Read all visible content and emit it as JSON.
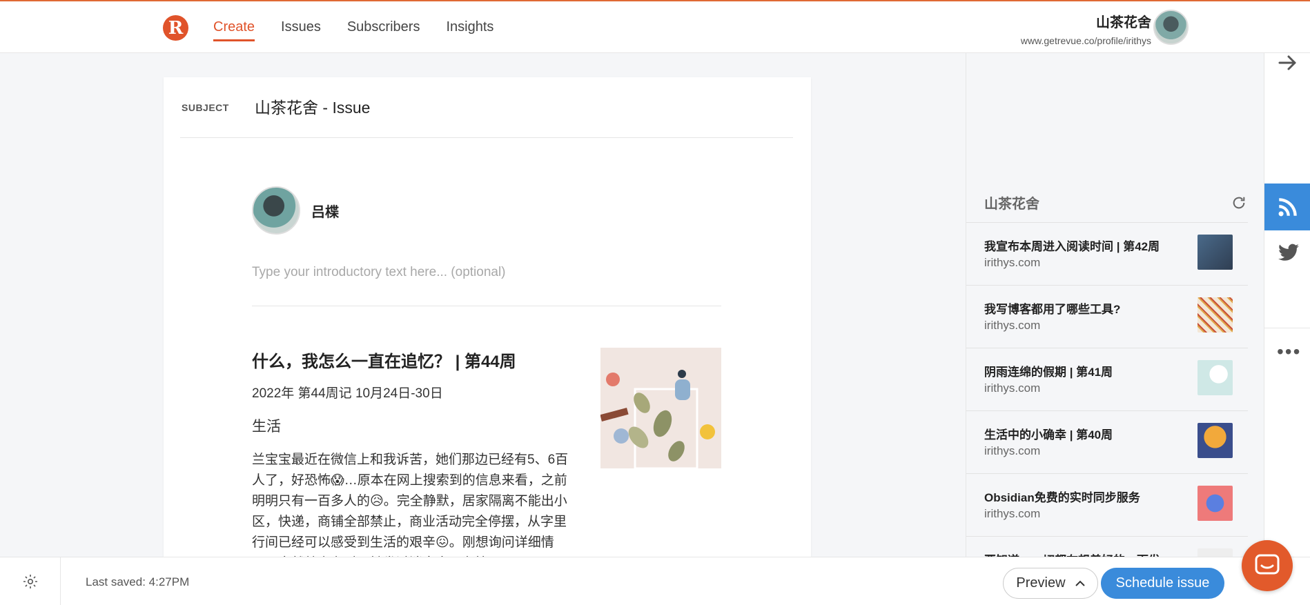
{
  "app": {
    "logo_letter": "R",
    "nav": [
      {
        "label": "Create",
        "active": true
      },
      {
        "label": "Issues"
      },
      {
        "label": "Subscribers"
      },
      {
        "label": "Insights"
      }
    ],
    "profile": {
      "name": "山茶花舍",
      "url": "www.getrevue.co/profile/irithys"
    },
    "accent_color": "#e0532a",
    "primary_color": "#3a8bdb"
  },
  "editor": {
    "subject_label": "SUBJECT",
    "subject_value": "山茶花舍 - Issue",
    "author_name": "吕楪",
    "intro_placeholder": "Type your introductory text here... (optional)",
    "article": {
      "title": "什么，我怎么一直在追忆？ | 第44周",
      "date": "2022年 第44周记 10月24日-30日",
      "tag": "生活",
      "body": "兰宝宝最近在微信上和我诉苦，她们那边已经有5、6百人了，好恐怖😱…原本在网上搜索到的信息来看，之前明明只有一百多人的😥。完全静默，居家隔离不能出小区，快递，商铺全部禁止，商业活动完全停摆，从字里行间已经可以感受到生活的艰辛😖。刚想询问详细情况，突然就宣布时，她发过消息来：在检"
    }
  },
  "feed": {
    "title": "山茶花舍",
    "items": [
      {
        "title": "我宣布本周进入阅读时间 | 第42周",
        "site": "irithys.com"
      },
      {
        "title": "我写博客都用了哪些工具?",
        "site": "irithys.com"
      },
      {
        "title": "阴雨连绵的假期 | 第41周",
        "site": "irithys.com"
      },
      {
        "title": "生活中的小确幸 | 第40周",
        "site": "irithys.com"
      },
      {
        "title": "Obsidian免费的实时同步服务",
        "site": "irithys.com"
      },
      {
        "title": "要知道，一切都在想着好的一面发",
        "site": ""
      }
    ]
  },
  "bottom": {
    "last_saved": "Last saved: 4:27PM",
    "preview_label": "Preview",
    "schedule_label": "Schedule issue"
  }
}
